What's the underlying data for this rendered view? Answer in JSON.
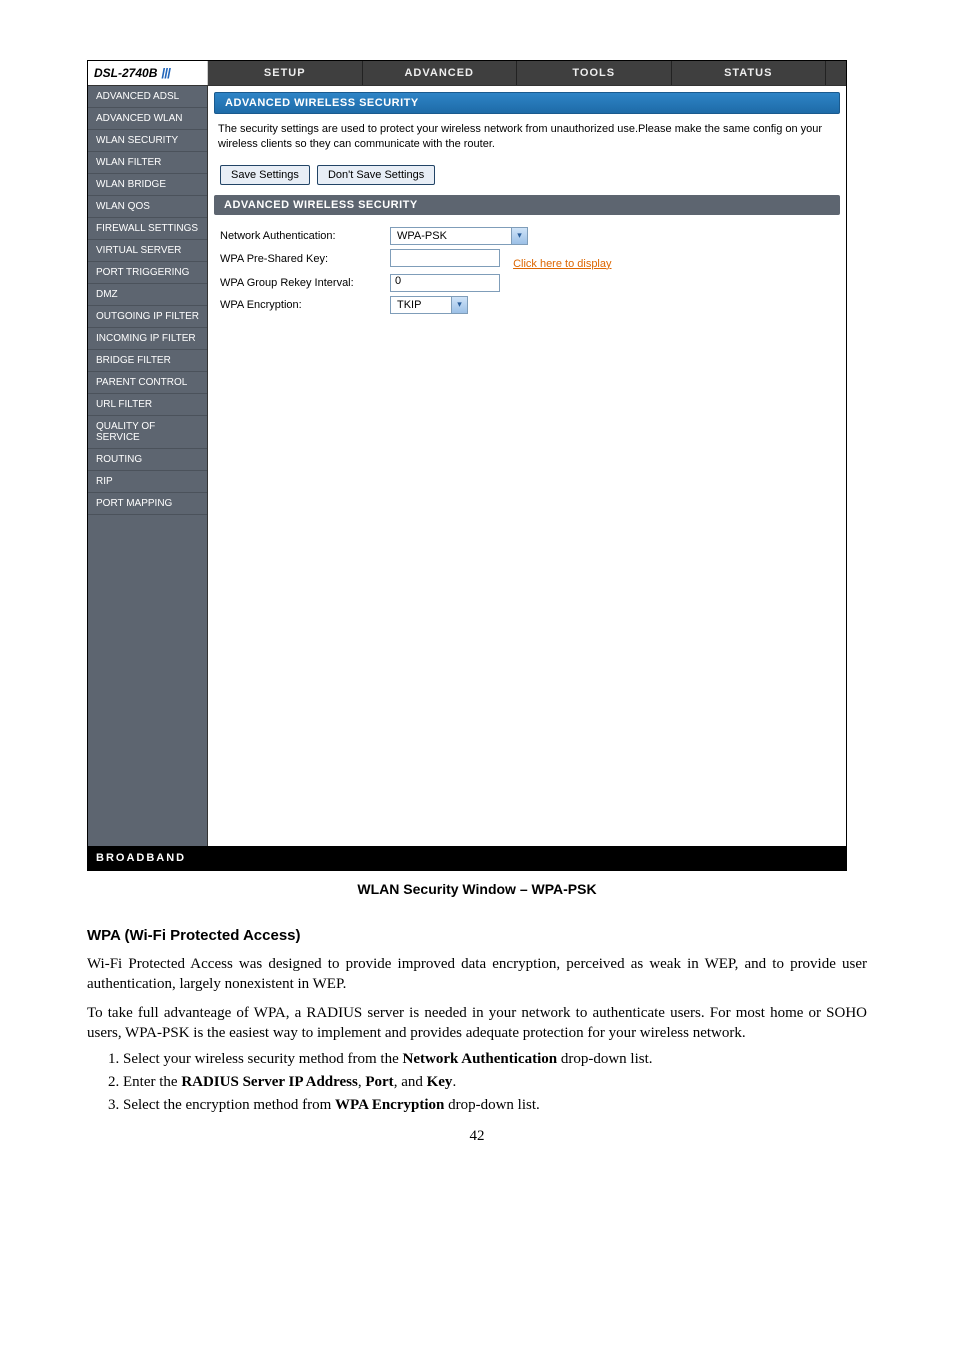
{
  "logo": {
    "model": "DSL-2740B"
  },
  "topnav": [
    "SETUP",
    "ADVANCED",
    "TOOLS",
    "STATUS"
  ],
  "sidebar": {
    "items": [
      "ADVANCED ADSL",
      "ADVANCED WLAN",
      "WLAN SECURITY",
      "WLAN FILTER",
      "WLAN BRIDGE",
      "WLAN QOS",
      "FIREWALL SETTINGS",
      "VIRTUAL SERVER",
      "PORT TRIGGERING",
      "DMZ",
      "OUTGOING IP FILTER",
      "INCOMING IP FILTER",
      "BRIDGE FILTER",
      "PARENT CONTROL",
      "URL FILTER",
      "QUALITY OF SERVICE",
      "ROUTING",
      "RIP",
      "PORT MAPPING"
    ]
  },
  "panel": {
    "title": "ADVANCED WIRELESS SECURITY",
    "desc": "The security settings are used to protect your wireless network from unauthorized use.Please make the same config on your wireless clients so they can communicate with the router.",
    "save": "Save Settings",
    "dont_save": "Don't Save Settings",
    "subtitle": "ADVANCED WIRELESS SECURITY"
  },
  "form": {
    "auth_label": "Network Authentication:",
    "auth_value": "WPA-PSK",
    "psk_label": "WPA Pre-Shared Key:",
    "psk_value": "",
    "psk_link": "Click here to display",
    "rekey_label": "WPA Group Rekey Interval:",
    "rekey_value": "0",
    "enc_label": "WPA Encryption:",
    "enc_value": "TKIP"
  },
  "footer": "BROADBAND",
  "figcaption": "WLAN Security Window – WPA-PSK",
  "doc": {
    "h3": "WPA (Wi-Fi Protected Access)",
    "p1": "Wi-Fi Protected Access was designed to provide improved data encryption, perceived as weak in WEP, and to provide user authentication, largely nonexistent in WEP.",
    "p2": "To take full advanteage of WPA, a RADIUS server is needed in your network to authenticate users. For most home or SOHO users, WPA-PSK is the easiest way to implement and provides adequate protection for your wireless network.",
    "li1a": "Select your wireless security method from the ",
    "li1b": "Network Authentication",
    "li1c": " drop-down list.",
    "li2a": "Enter the ",
    "li2b": "RADIUS Server IP Address",
    "li2c": ", ",
    "li2d": "Port",
    "li2e": ", and ",
    "li2f": "Key",
    "li2g": ".",
    "li3a": "Select the encryption method from ",
    "li3b": "WPA Encryption",
    "li3c": " drop-down list."
  },
  "pagenum": "42"
}
